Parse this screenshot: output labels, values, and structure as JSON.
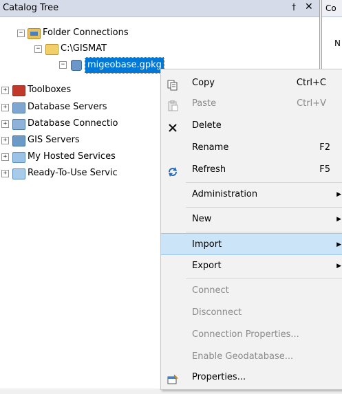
{
  "panel": {
    "title": "Catalog Tree",
    "pin_glyph": "†",
    "close_glyph": "✕"
  },
  "right_panel": {
    "tab_text": "Co",
    "text": "N"
  },
  "tree": [
    {
      "label": "Folder Connections",
      "icon": "folder-connections-icon",
      "expander": "−"
    },
    {
      "label": "C:\\GISMAT",
      "icon": "folder-icon",
      "expander": "−"
    },
    {
      "label": "migeobase.gpkg",
      "icon": "database-icon",
      "expander": "−",
      "selected": true
    },
    {
      "label": "Toolboxes",
      "icon": "toolbox-icon",
      "expander": "+"
    },
    {
      "label": "Database Servers",
      "icon": "database-server-icon",
      "expander": "+"
    },
    {
      "label": "Database Connectio",
      "icon": "database-connection-icon",
      "expander": "+"
    },
    {
      "label": "GIS Servers",
      "icon": "gis-server-icon",
      "expander": "+"
    },
    {
      "label": "My Hosted Services",
      "icon": "hosted-services-icon",
      "expander": "+"
    },
    {
      "label": "Ready-To-Use Servic",
      "icon": "ready-services-icon",
      "expander": "+"
    }
  ],
  "context_menu": {
    "items": [
      {
        "label": "Copy",
        "shortcut": "Ctrl+C",
        "icon": "copy-icon",
        "disabled": false
      },
      {
        "label": "Paste",
        "shortcut": "Ctrl+V",
        "icon": "paste-icon",
        "disabled": true
      },
      {
        "label": "Delete",
        "shortcut": "",
        "icon": "delete-icon",
        "disabled": false
      },
      {
        "label": "Rename",
        "shortcut": "F2",
        "icon": "",
        "disabled": false
      },
      {
        "label": "Refresh",
        "shortcut": "F5",
        "icon": "refresh-icon",
        "disabled": false
      },
      {
        "label": "Administration",
        "submenu": true,
        "disabled": false
      },
      {
        "label": "New",
        "submenu": true,
        "disabled": false
      },
      {
        "label": "Import",
        "submenu": true,
        "disabled": false,
        "highlighted": true
      },
      {
        "label": "Export",
        "submenu": true,
        "disabled": false
      },
      {
        "label": "Connect",
        "disabled": true
      },
      {
        "label": "Disconnect",
        "disabled": true
      },
      {
        "label": "Connection Properties...",
        "disabled": true
      },
      {
        "label": "Enable Geodatabase...",
        "disabled": true
      },
      {
        "label": "Properties...",
        "icon": "properties-icon",
        "disabled": false
      }
    ],
    "submenu_arrow": "▶"
  },
  "colors": {
    "selection": "#0078d7",
    "menu_highlight": "#cce4f7",
    "disabled_text": "#8a8a8a"
  }
}
